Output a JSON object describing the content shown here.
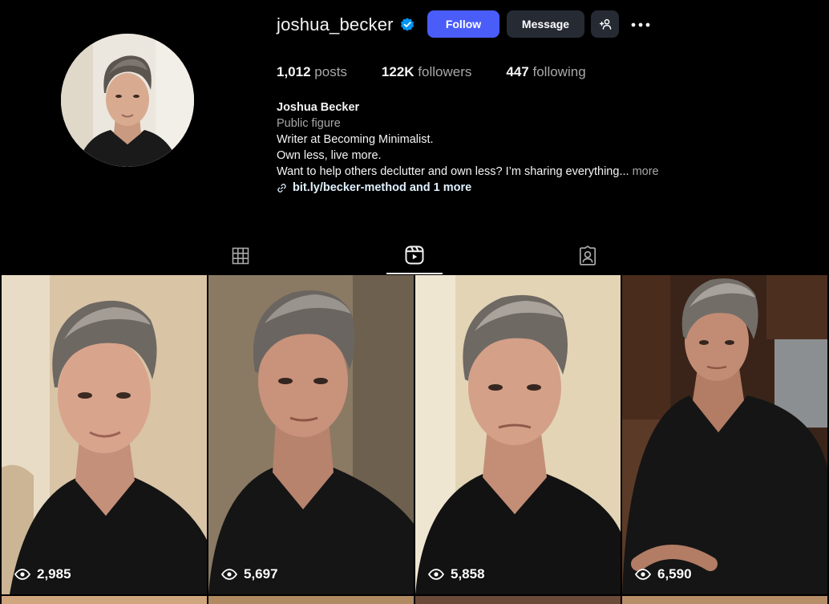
{
  "profile": {
    "username": "joshua_becker",
    "verified": true,
    "follow_label": "Follow",
    "message_label": "Message",
    "stats": [
      {
        "value": "1,012",
        "label": "posts"
      },
      {
        "value": "122K",
        "label": "followers"
      },
      {
        "value": "447",
        "label": "following"
      }
    ],
    "name": "Joshua Becker",
    "category": "Public figure",
    "bio_lines": [
      "Writer at Becoming Minimalist.",
      "Own less, live more.",
      "Want to help others declutter and own less? I’m sharing everything..."
    ],
    "more_label": "more",
    "link_text": "bit.ly/becker-method and 1 more"
  },
  "tabs": [
    {
      "name": "posts",
      "icon": "grid-icon",
      "active": false
    },
    {
      "name": "reels",
      "icon": "reels-icon",
      "active": true
    },
    {
      "name": "tagged",
      "icon": "tagged-icon",
      "active": false
    }
  ],
  "reels": [
    {
      "views": "2,985"
    },
    {
      "views": "5,697"
    },
    {
      "views": "5,858"
    },
    {
      "views": "6,590"
    }
  ],
  "colors": {
    "background": "#000000",
    "follow_button": "#4a5df9",
    "secondary_button": "#262a33",
    "verified_badge": "#0095f6",
    "muted_text": "#a8a8a8"
  }
}
